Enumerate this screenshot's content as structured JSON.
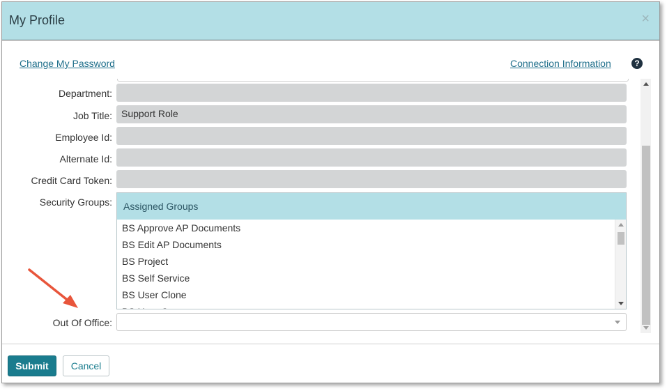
{
  "dialog": {
    "title": "My Profile",
    "close_glyph": "×"
  },
  "links": {
    "change_password": "Change My Password",
    "connection_info": "Connection Information",
    "help_glyph": "?"
  },
  "form": {
    "department": {
      "label": "Department:",
      "value": ""
    },
    "job_title": {
      "label": "Job Title:",
      "value": "Support Role"
    },
    "employee_id": {
      "label": "Employee Id:",
      "value": ""
    },
    "alternate_id": {
      "label": "Alternate Id:",
      "value": ""
    },
    "credit_card_token": {
      "label": "Credit Card Token:",
      "value": ""
    },
    "security_groups": {
      "label": "Security Groups:",
      "header": "Assigned Groups",
      "items": [
        "BS Approve AP Documents",
        "BS Edit AP Documents",
        "BS Project",
        "BS Self Service",
        "BS User Clone",
        "BS User Cr..."
      ]
    },
    "out_of_office": {
      "label": "Out Of Office:",
      "value": ""
    }
  },
  "footer": {
    "submit_label": "Submit",
    "cancel_label": "Cancel"
  },
  "colors": {
    "header_bg": "#b3dfe6",
    "accent": "#1a7c8e",
    "link": "#1f6f8b",
    "annotation_arrow": "#e8553b"
  },
  "icons": {
    "close": "close-icon",
    "help": "help-icon",
    "dropdown": "chevron-down-icon"
  }
}
